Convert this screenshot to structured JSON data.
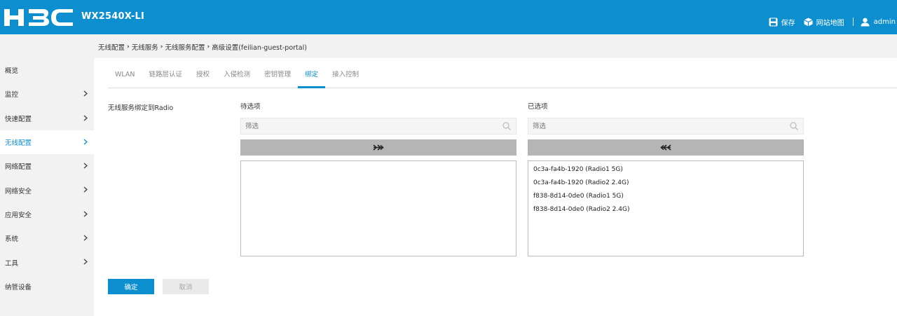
{
  "header": {
    "logo_text": "H3C",
    "model": "WX2540X-LI",
    "actions": [
      {
        "icon": "save-icon",
        "label": "保存"
      },
      {
        "icon": "sitemap-icon",
        "label": "网站地图"
      }
    ],
    "user": {
      "icon": "user-icon",
      "label": "admin"
    },
    "colors": {
      "brand": "#0d8fcf"
    }
  },
  "breadcrumb": [
    "无线配置",
    "无线服务",
    "无线服务配置",
    "高级设置(feilian-guest-portal)"
  ],
  "sidebar": {
    "items": [
      {
        "label": "概览",
        "chevron": false
      },
      {
        "label": "监控",
        "chevron": true
      },
      {
        "label": "快速配置",
        "chevron": true
      },
      {
        "label": "无线配置",
        "chevron": true,
        "active": true
      },
      {
        "label": "网络配置",
        "chevron": true
      },
      {
        "label": "网络安全",
        "chevron": true
      },
      {
        "label": "应用安全",
        "chevron": true
      },
      {
        "label": "系统",
        "chevron": true
      },
      {
        "label": "工具",
        "chevron": true
      },
      {
        "label": "纳管设备",
        "chevron": false
      }
    ]
  },
  "tabs": [
    {
      "label": "WLAN"
    },
    {
      "label": "链路层认证"
    },
    {
      "label": "授权"
    },
    {
      "label": "入侵检测"
    },
    {
      "label": "密钥管理"
    },
    {
      "label": "绑定",
      "active": true
    },
    {
      "label": "接入控制"
    }
  ],
  "form": {
    "field_label": "无线服务绑定到Radio",
    "available": {
      "title": "待选项",
      "filter_placeholder": "筛选",
      "move_icon": "move-right-icon",
      "items": []
    },
    "selected": {
      "title": "已选项",
      "filter_placeholder": "筛选",
      "move_icon": "move-left-icon",
      "items": [
        "0c3a-fa4b-1920 (Radio1 5G)",
        "0c3a-fa4b-1920 (Radio2 2.4G)",
        "f838-8d14-0de0 (Radio1 5G)",
        "f838-8d14-0de0 (Radio2 2.4G)"
      ]
    }
  },
  "buttons": {
    "ok": "确定",
    "cancel": "取消"
  }
}
